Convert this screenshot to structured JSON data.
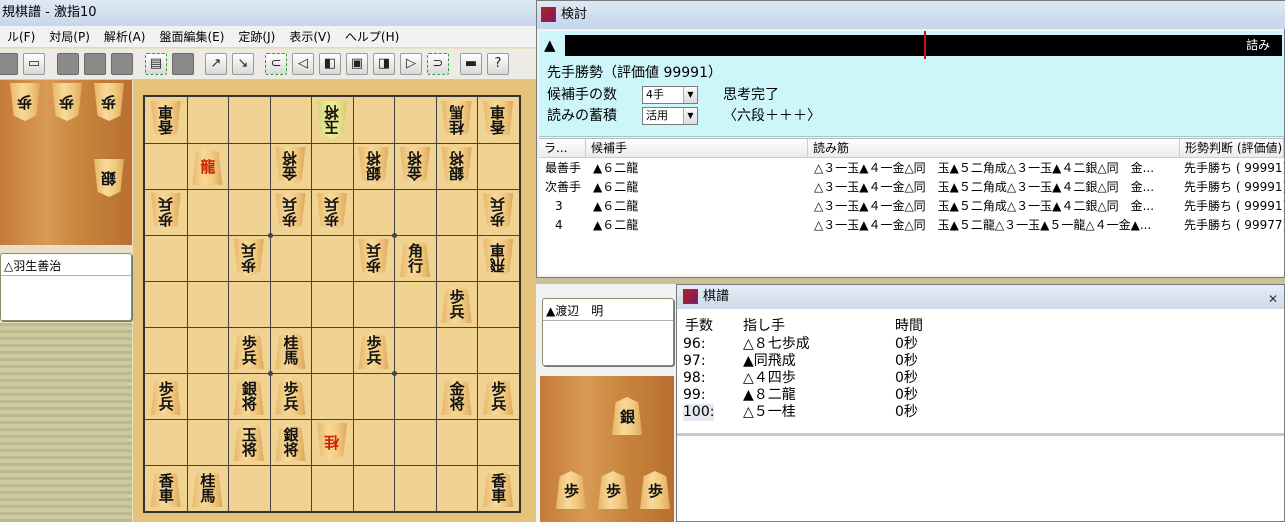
{
  "main": {
    "title": "規棋譜 - 激指10",
    "menu": [
      "ル(F)",
      "対局(P)",
      "解析(A)",
      "盤面編集(E)",
      "定跡(J)",
      "表示(V)",
      "ヘルプ(H)"
    ],
    "toolbar_icons": [
      "printer-icon",
      "open-file-icon",
      "gray-box-icon",
      "gray-box-icon",
      "gray-box-icon",
      "book-icon",
      "blank-icon",
      "arrow-icon",
      "arrow-icon",
      "first-icon",
      "prev-icon",
      "stop-icon",
      "next-icon",
      "play-icon",
      "last-icon",
      "monitor-icon",
      "help-icon"
    ]
  },
  "players": {
    "gote_name": "△羽生善治",
    "sente_name": "▲渡辺　明"
  },
  "hands": {
    "gote": [
      "歩",
      "歩",
      "歩",
      "銀"
    ],
    "sente": [
      "銀",
      "歩",
      "歩",
      "歩"
    ]
  },
  "board": {
    "pieces": [
      {
        "c": 0,
        "r": 0,
        "k": "香車",
        "o": "g"
      },
      {
        "c": 4,
        "r": 0,
        "k": "玉将",
        "o": "g",
        "hl": true
      },
      {
        "c": 7,
        "r": 0,
        "k": "桂馬",
        "o": "g"
      },
      {
        "c": 8,
        "r": 0,
        "k": "香車",
        "o": "g"
      },
      {
        "c": 1,
        "r": 1,
        "k": "龍",
        "o": "s",
        "p": true
      },
      {
        "c": 3,
        "r": 1,
        "k": "金将",
        "o": "g"
      },
      {
        "c": 5,
        "r": 1,
        "k": "銀将",
        "o": "g"
      },
      {
        "c": 6,
        "r": 1,
        "k": "金将",
        "o": "g"
      },
      {
        "c": 7,
        "r": 1,
        "k": "銀将",
        "o": "g"
      },
      {
        "c": 0,
        "r": 2,
        "k": "歩兵",
        "o": "g"
      },
      {
        "c": 3,
        "r": 2,
        "k": "歩兵",
        "o": "g"
      },
      {
        "c": 4,
        "r": 2,
        "k": "歩兵",
        "o": "g"
      },
      {
        "c": 8,
        "r": 2,
        "k": "歩兵",
        "o": "g"
      },
      {
        "c": 2,
        "r": 3,
        "k": "歩兵",
        "o": "g"
      },
      {
        "c": 5,
        "r": 3,
        "k": "歩兵",
        "o": "g"
      },
      {
        "c": 6,
        "r": 3,
        "k": "角行",
        "o": "s"
      },
      {
        "c": 8,
        "r": 3,
        "k": "飛車",
        "o": "g"
      },
      {
        "c": 7,
        "r": 4,
        "k": "歩兵",
        "o": "s"
      },
      {
        "c": 2,
        "r": 5,
        "k": "歩兵",
        "o": "s"
      },
      {
        "c": 3,
        "r": 5,
        "k": "桂馬",
        "o": "s"
      },
      {
        "c": 5,
        "r": 5,
        "k": "歩兵",
        "o": "s"
      },
      {
        "c": 0,
        "r": 6,
        "k": "歩兵",
        "o": "s"
      },
      {
        "c": 2,
        "r": 6,
        "k": "銀将",
        "o": "s"
      },
      {
        "c": 3,
        "r": 6,
        "k": "歩兵",
        "o": "s"
      },
      {
        "c": 7,
        "r": 6,
        "k": "金将",
        "o": "s"
      },
      {
        "c": 8,
        "r": 6,
        "k": "歩兵",
        "o": "s"
      },
      {
        "c": 2,
        "r": 7,
        "k": "玉将",
        "o": "s"
      },
      {
        "c": 3,
        "r": 7,
        "k": "銀将",
        "o": "s"
      },
      {
        "c": 4,
        "r": 7,
        "k": "桂",
        "o": "g",
        "p": true
      },
      {
        "c": 0,
        "r": 8,
        "k": "香車",
        "o": "s"
      },
      {
        "c": 1,
        "r": 8,
        "k": "桂馬",
        "o": "s"
      },
      {
        "c": 8,
        "r": 8,
        "k": "香車",
        "o": "s"
      }
    ]
  },
  "analysis": {
    "title": "検討",
    "bar_triangle": "▲",
    "bar_text": "詰み",
    "eval_marker_fraction": 0.5,
    "status": "先手勝勢（評価値 99991）",
    "candidates_label": "候補手の数",
    "candidates_value": "4手",
    "accumulate_label": "読みの蓄積",
    "accumulate_value": "活用",
    "thinking_status": "思考完了",
    "level": "〈六段＋＋＋〉",
    "columns": [
      "ラ...",
      "候補手",
      "読み筋",
      "形勢判断 (評価値)"
    ],
    "rows": [
      {
        "rank": "最善手",
        "move": "▲６二龍",
        "line": "△３一玉▲４一金△同　玉▲５二角成△３一玉▲４二銀△同　金...",
        "eval": "先手勝ち ( 99991)"
      },
      {
        "rank": "次善手",
        "move": "▲６二龍",
        "line": "△３一玉▲４一金△同　玉▲５二角成△３一玉▲４二銀△同　金...",
        "eval": "先手勝ち ( 99991)"
      },
      {
        "rank": "3",
        "move": "▲６二龍",
        "line": "△３一玉▲４一金△同　玉▲５二角成△３一玉▲４二銀△同　金...",
        "eval": "先手勝ち ( 99991)"
      },
      {
        "rank": "4",
        "move": "▲６二龍",
        "line": "△３一玉▲４一金△同　玉▲５二龍△３一玉▲５一龍△４一金▲...",
        "eval": "先手勝ち ( 99977)"
      }
    ]
  },
  "kifu": {
    "title": "棋譜",
    "columns": [
      "手数",
      "指し手",
      "時間"
    ],
    "rows": [
      {
        "num": "96:",
        "move": "△８七歩成",
        "time": "0秒"
      },
      {
        "num": "97:",
        "move": "▲同飛成",
        "time": "0秒"
      },
      {
        "num": "98:",
        "move": "△４四歩",
        "time": "0秒"
      },
      {
        "num": "99:",
        "move": "▲８二龍",
        "time": "0秒"
      },
      {
        "num": "100:",
        "move": "△５一桂",
        "time": "0秒"
      }
    ]
  }
}
